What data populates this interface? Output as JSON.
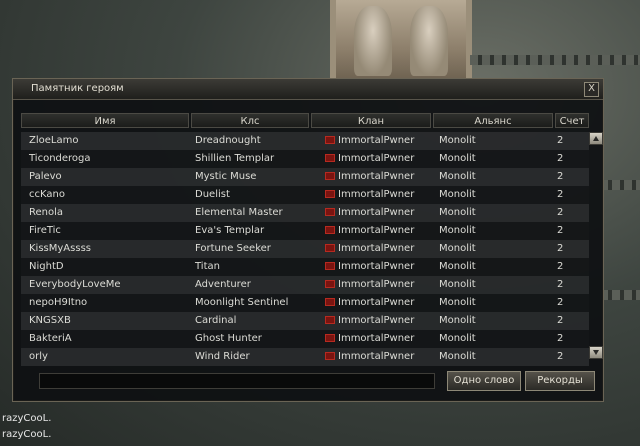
{
  "window": {
    "title": "Памятник героям",
    "close_label": "X"
  },
  "columns": [
    "Имя",
    "Клс",
    "Клан",
    "Альянс",
    "Счет"
  ],
  "rows": [
    {
      "name": "ZloeLamo",
      "class": "Dreadnought",
      "clan": "ImmortalPwner",
      "alliance": "Monolit",
      "score": "2"
    },
    {
      "name": "Ticonderoga",
      "class": "Shillien Templar",
      "clan": "ImmortalPwner",
      "alliance": "Monolit",
      "score": "2"
    },
    {
      "name": "Palevo",
      "class": "Mystic Muse",
      "clan": "ImmortalPwner",
      "alliance": "Monolit",
      "score": "2"
    },
    {
      "name": "ccKano",
      "class": "Duelist",
      "clan": "ImmortalPwner",
      "alliance": "Monolit",
      "score": "2"
    },
    {
      "name": "Renola",
      "class": "Elemental Master",
      "clan": "ImmortalPwner",
      "alliance": "Monolit",
      "score": "2"
    },
    {
      "name": "FireTic",
      "class": "Eva's Templar",
      "clan": "ImmortalPwner",
      "alliance": "Monolit",
      "score": "2"
    },
    {
      "name": "KissMyAssss",
      "class": "Fortune Seeker",
      "clan": "ImmortalPwner",
      "alliance": "Monolit",
      "score": "2"
    },
    {
      "name": "NightD",
      "class": "Titan",
      "clan": "ImmortalPwner",
      "alliance": "Monolit",
      "score": "2"
    },
    {
      "name": "EverybodyLoveMe",
      "class": "Adventurer",
      "clan": "ImmortalPwner",
      "alliance": "Monolit",
      "score": "2"
    },
    {
      "name": "nepoH9Itno",
      "class": "Moonlight Sentinel",
      "clan": "ImmortalPwner",
      "alliance": "Monolit",
      "score": "2"
    },
    {
      "name": "KNGSXB",
      "class": "Cardinal",
      "clan": "ImmortalPwner",
      "alliance": "Monolit",
      "score": "2"
    },
    {
      "name": "BakteriA",
      "class": "Ghost Hunter",
      "clan": "ImmortalPwner",
      "alliance": "Monolit",
      "score": "2"
    },
    {
      "name": "orly",
      "class": "Wind Rider",
      "clan": "ImmortalPwner",
      "alliance": "Monolit",
      "score": "2"
    }
  ],
  "search": {
    "value": ""
  },
  "buttons": {
    "one_word": "Одно слово",
    "records": "Рекорды"
  },
  "chat_lines": [
    "razyCooL.",
    "razyCooL."
  ],
  "colors": {
    "clan_emblem": "#7a1410",
    "window_border": "#6a6455"
  },
  "icons": {
    "clan": "clan-emblem-icon",
    "close": "close-icon",
    "scroll_up": "arrow-up-icon",
    "scroll_down": "arrow-down-icon"
  }
}
